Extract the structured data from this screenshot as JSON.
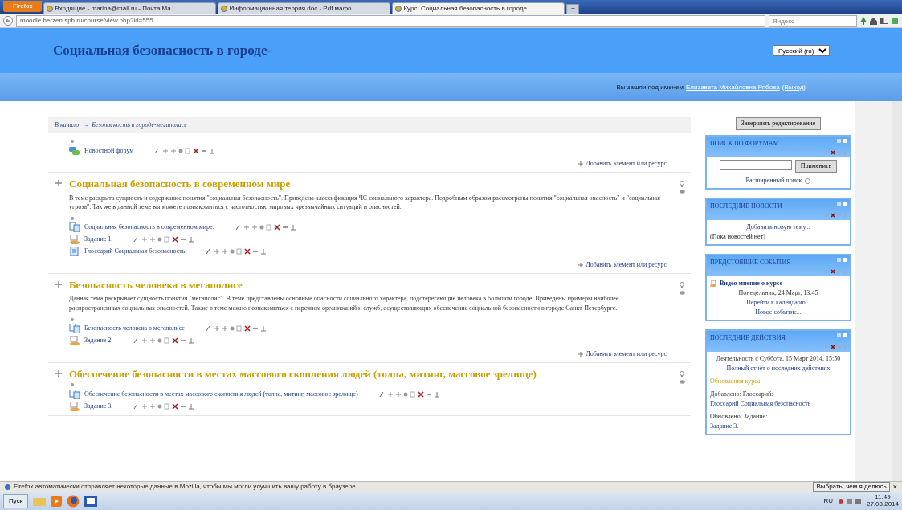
{
  "browser": {
    "firefox_button": "Firefox",
    "tabs": [
      {
        "title": "Входящие - marina@mail.ru - Почта Ma...",
        "selected": false
      },
      {
        "title": "Информационная теория.doc - Pdf мафо...",
        "selected": false
      },
      {
        "title": "Курс: Социальная безопасность в городе...",
        "selected": true
      }
    ],
    "new_tab": "+",
    "url": "moodle.herzen.spb.ru/course/view.php?id=555",
    "search_placeholder": "Яндекс"
  },
  "header": {
    "title": "Социальная безопасность в городе-",
    "language": "Русский (ru)",
    "login_text": "Вы зашли под именем",
    "user_name": "Елизавета Михайловна Рябова",
    "logout": "(Выход)"
  },
  "breadcrumb": {
    "separator": "→",
    "items": [
      "В начало",
      "Безопасность в городе-мегаполисе"
    ]
  },
  "sections": [
    {
      "activities": [
        {
          "kind": "forum",
          "name": "Новостной форум"
        }
      ],
      "add_link": "Добавить элемент или ресурс"
    },
    {
      "title": "Социальная безопасность в современном мире",
      "summary": "В теме раскрыта сущность и содержание понятия \"социальная безопасность\". Приведена классификация ЧС социального характера. Подробным образом рассмотрены понятия \"социальная опасность\" и \"социальная угроза\". Так же в данной теме вы можете познакомиться с частотностью мировых чрезвычайных ситуаций и опасностей.",
      "activities": [
        {
          "kind": "page",
          "name": "Социальная безопасность в современном мире."
        },
        {
          "kind": "assign",
          "name": "Задание 1."
        },
        {
          "kind": "glossary",
          "name": "Глоссарий Социальная безопасность"
        }
      ],
      "add_link": "Добавить элемент или ресурс"
    },
    {
      "title": "Безопасность человека в мегаполисе",
      "summary": "Данная тема раскрывает сущность понятия \"мегаполис\". В теме представлены основные опасности социального характера, подстерегающие человека в большом городе. Приведены примеры наиболее распространенных социальных опасностей. Также в теме можно познакомиться с перечнем организаций и служб, осуществляющих обеспечение социальной безопасности в городе Санкт-Петербурге.",
      "activities": [
        {
          "kind": "page",
          "name": "Безопасность человека в мегаполисе"
        },
        {
          "kind": "assign",
          "name": "Задание 2."
        }
      ],
      "add_link": "Добавить элемент или ресурс"
    },
    {
      "title": "Обеспечение безопасности в местах массового скопления людей (толпа, митинг, массовое зрелище)",
      "activities": [
        {
          "kind": "page",
          "name": "Обеспечение безопасности в местах массового скопления людей (толпа, митинг, массовое зрелище)"
        },
        {
          "kind": "assign",
          "name": "Задание 3."
        }
      ]
    }
  ],
  "sidebar": {
    "finish_button": "Завершить редактирование",
    "blocks": [
      {
        "kind": "search",
        "title": "ПОИСК ПО ФОРУМАМ",
        "button": "Применить",
        "advanced": "Расширенный поиск"
      },
      {
        "kind": "list",
        "title": "ПОСЛЕДНИЕ НОВОСТИ",
        "lines": [
          {
            "kind": "link",
            "text": "Добавить новую тему..."
          },
          {
            "kind": "text",
            "text": "(Пока новостей нет)"
          }
        ]
      },
      {
        "kind": "list",
        "title": "ПРЕДСТОЯЩИЕ СОБЫТИЯ",
        "lines": [
          {
            "kind": "event",
            "text": "Видео мнение о курсе"
          },
          {
            "kind": "date",
            "text": "Понедельник, 24 Март, 13:45"
          },
          {
            "kind": "link",
            "text": "Перейти к календарю..."
          },
          {
            "kind": "link",
            "text": "Новое событие..."
          }
        ]
      },
      {
        "kind": "list",
        "title": "ПОСЛЕДНИЕ ДЕЙСТВИЯ",
        "lines": [
          {
            "kind": "date",
            "text": "Деятельность с Суббота, 15 Март 2014, 15:50"
          },
          {
            "kind": "link",
            "text": "Полный отчет о последних действиях"
          },
          {
            "kind": "heading",
            "text": "Обновления курса:"
          },
          {
            "kind": "plain",
            "text": "Добавлено: Глоссарий:"
          },
          {
            "kind": "plainlink",
            "text": "Глоссарий Социальная безопасность"
          },
          {
            "kind": "plain",
            "text": "Обновлено: Задание:"
          },
          {
            "kind": "plainlink",
            "text": "Задание 3."
          }
        ]
      }
    ]
  },
  "notification": {
    "text": "Firefox автоматически отправляет некоторые данные в Mozilla, чтобы мы могли улучшить вашу работу в браузере.",
    "button": "Выбрать, чем я делюсь",
    "close": "×"
  },
  "taskbar": {
    "start": "Пуск",
    "language": "RU",
    "time": "11:49",
    "date": "27.03.2014"
  }
}
